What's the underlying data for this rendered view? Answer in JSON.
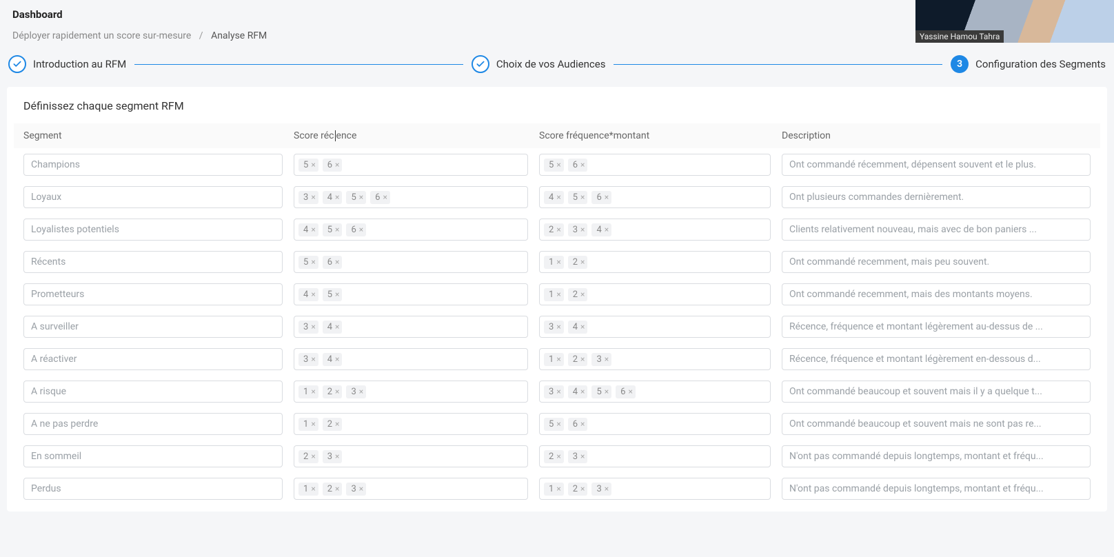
{
  "header": {
    "title": "Dashboard"
  },
  "breadcrumb": {
    "root": "Déployer rapidement un score sur-mesure",
    "sep": "/",
    "current": "Analyse RFM"
  },
  "stepper": {
    "s1": {
      "label": "Introduction au RFM"
    },
    "s2": {
      "label": "Choix de vos Audiences"
    },
    "s3": {
      "num": "3",
      "label": "Configuration des Segments"
    }
  },
  "panel": {
    "title": "Définissez chaque segment RFM"
  },
  "columns": {
    "seg": "Segment",
    "rec": "Score récence",
    "fm": "Score fréquence*montant",
    "desc": "Description"
  },
  "rows": [
    {
      "segment": "Champions",
      "recence": [
        "5",
        "6"
      ],
      "fm": [
        "5",
        "6"
      ],
      "desc": "Ont commandé récemment, dépensent souvent et le plus."
    },
    {
      "segment": "Loyaux",
      "recence": [
        "3",
        "4",
        "5",
        "6"
      ],
      "fm": [
        "4",
        "5",
        "6"
      ],
      "desc": "Ont plusieurs commandes dernièrement."
    },
    {
      "segment": "Loyalistes potentiels",
      "recence": [
        "4",
        "5",
        "6"
      ],
      "fm": [
        "2",
        "3",
        "4"
      ],
      "desc": "Clients relativement nouveau, mais avec de bon paniers ..."
    },
    {
      "segment": "Récents",
      "recence": [
        "5",
        "6"
      ],
      "fm": [
        "1",
        "2"
      ],
      "desc": "Ont commandé recemment, mais peu souvent."
    },
    {
      "segment": "Prometteurs",
      "recence": [
        "4",
        "5"
      ],
      "fm": [
        "1",
        "2"
      ],
      "desc": "Ont commandé recemment, mais des montants moyens."
    },
    {
      "segment": "A surveiller",
      "recence": [
        "3",
        "4"
      ],
      "fm": [
        "3",
        "4"
      ],
      "desc": "Récence, fréquence et montant légèrement au-dessus de ..."
    },
    {
      "segment": "A réactiver",
      "recence": [
        "3",
        "4"
      ],
      "fm": [
        "1",
        "2",
        "3"
      ],
      "desc": "Récence, fréquence et montant légèrement en-dessous d..."
    },
    {
      "segment": "A risque",
      "recence": [
        "1",
        "2",
        "3"
      ],
      "fm": [
        "3",
        "4",
        "5",
        "6"
      ],
      "desc": "Ont commandé beaucoup et souvent mais il y a quelque t..."
    },
    {
      "segment": "A ne pas perdre",
      "recence": [
        "1",
        "2"
      ],
      "fm": [
        "5",
        "6"
      ],
      "desc": "Ont commandé beaucoup et souvent mais ne sont pas re..."
    },
    {
      "segment": "En sommeil",
      "recence": [
        "2",
        "3"
      ],
      "fm": [
        "2",
        "3"
      ],
      "desc": "N'ont pas commandé depuis longtemps, montant et fréqu..."
    },
    {
      "segment": "Perdus",
      "recence": [
        "1",
        "2",
        "3"
      ],
      "fm": [
        "1",
        "2",
        "3"
      ],
      "desc": "N'ont pas commandé depuis longtemps, montant et fréqu..."
    }
  ],
  "overlay": {
    "name": "Yassine Hamou Tahra"
  }
}
